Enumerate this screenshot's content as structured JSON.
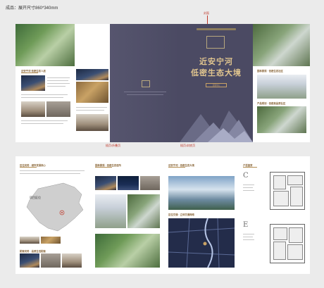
{
  "caption": "成品：展开尺寸860*340mm",
  "annotations": {
    "top_center": "封面",
    "bottom_left": "插页/折叠页",
    "bottom_right": "插页/封底页"
  },
  "cover": {
    "title_line1": "近安宁河",
    "title_line2": "低密生态大境",
    "badge": "营销中心"
  },
  "top_panels": {
    "panel1_heading": "近安宁河 低密生态人居",
    "panel5_heading_top": "园林景观 · 低密生态社区",
    "panel5_heading_mid": "产品规划 · 低密高品质社区"
  },
  "bottom_panels": {
    "bp1_heading": "区位优势 · 城市发展核心",
    "bp1_map_label": "项目区位",
    "bp1_footer_heading": "配套优势 · 品质生活配套",
    "bp2_heading": "园林景观 · 低密生态居所",
    "bp3_heading": "近安宁河 · 低密生态大境",
    "bp3_mid_heading": "区位交通 · 立体交通网络",
    "bp4_heading": "户型鉴赏",
    "plan_c_letter": "C",
    "plan_e_letter": "E"
  },
  "colors": {
    "cover_bg": "#4b4a63",
    "gold": "#c9a265",
    "annotation_red": "#c0392b"
  }
}
